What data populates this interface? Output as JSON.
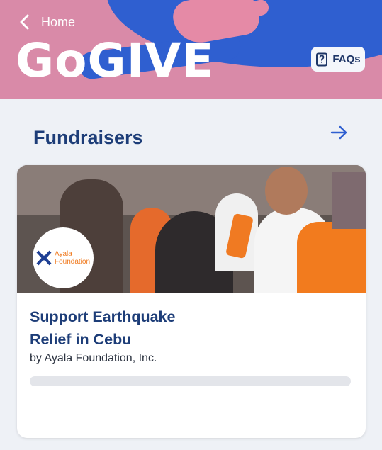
{
  "header": {
    "back_label": "Home",
    "brand": "GoGIVE",
    "faq_label": "FAQs"
  },
  "section": {
    "title": "Fundraisers"
  },
  "fundraiser": {
    "title": "Support Earthquake Relief in Cebu",
    "organizer": "by Ayala Foundation, Inc.",
    "logo_text_line1": "Ayala",
    "logo_text_line2": "Foundation",
    "progress_fraction": 0
  },
  "colors": {
    "accent": "#2f5fd0",
    "brand_pink": "#d98aa8",
    "title_navy": "#1d3d78"
  }
}
